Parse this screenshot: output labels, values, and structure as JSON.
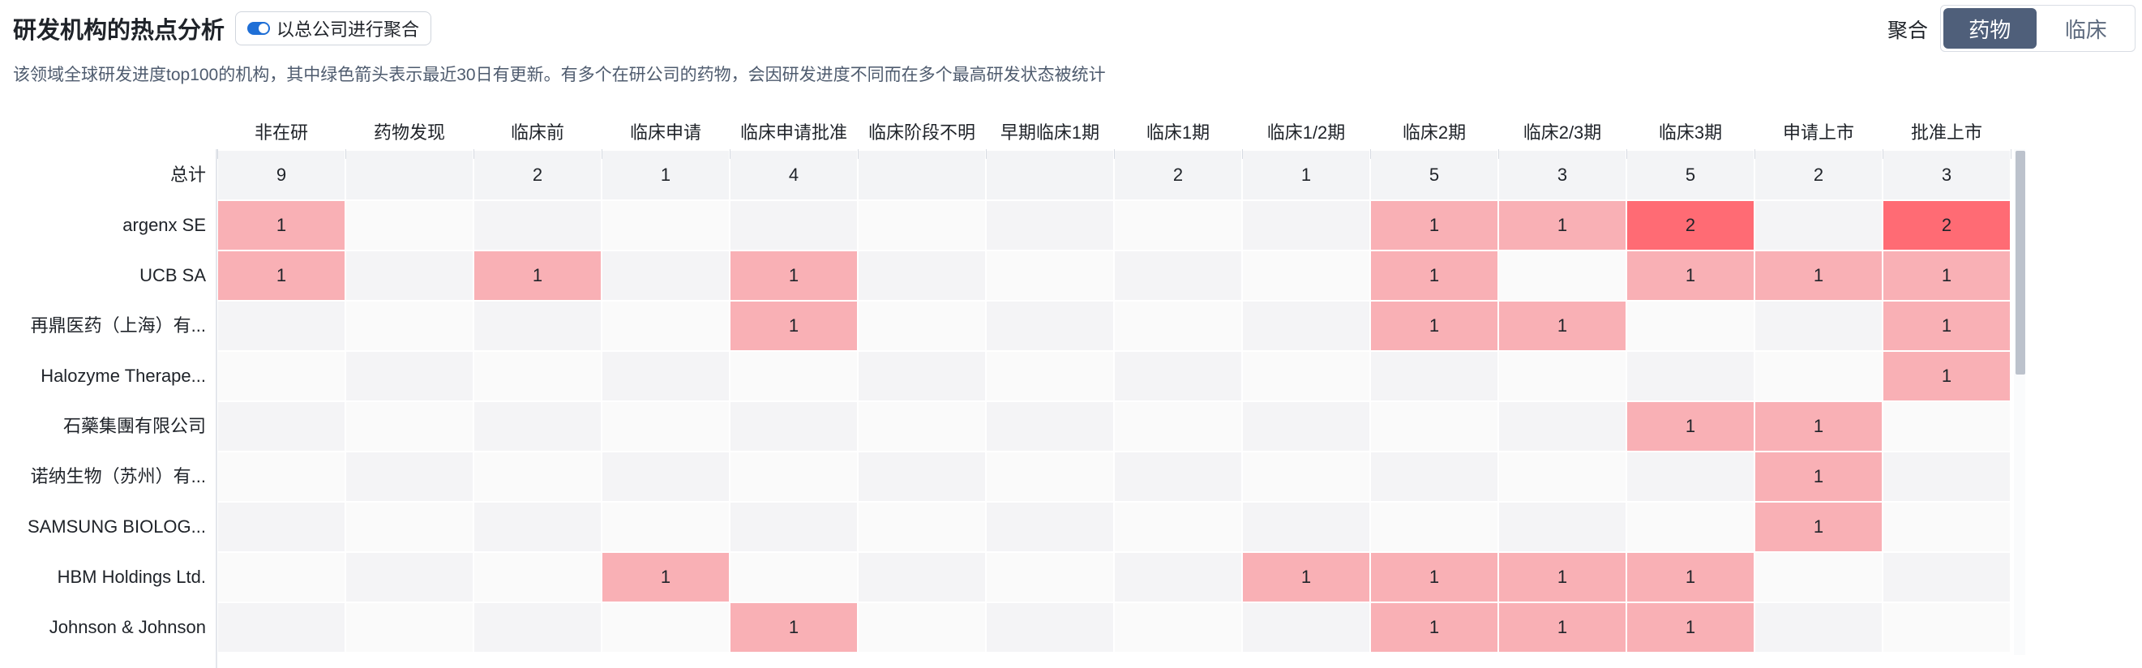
{
  "header": {
    "title": "研发机构的热点分析",
    "aggregate_toggle_label": "以总公司进行聚合",
    "aggregate_toggle_on": true,
    "subtitle": "该领域全球研发进度top100的机构，其中绿色箭头表示最近30日有更新。有多个在研公司的药物，会因研发进度不同而在多个最高研发状态被统计",
    "segment_label": "聚合",
    "segments": [
      {
        "label": "药物",
        "active": true
      },
      {
        "label": "临床",
        "active": false
      }
    ]
  },
  "colors": {
    "low": "#f9b0b5",
    "high": "#ff6b74",
    "total_bg": "#f3f4f6",
    "empty_a": "#fafafa",
    "empty_b": "#f4f4f6"
  },
  "chart_data": {
    "type": "heatmap",
    "columns": [
      "非在研",
      "药物发现",
      "临床前",
      "临床申请",
      "临床申请批准",
      "临床阶段不明",
      "早期临床1期",
      "临床1期",
      "临床1/2期",
      "临床2期",
      "临床2/3期",
      "临床3期",
      "申请上市",
      "批准上市"
    ],
    "total_row": {
      "label": "总计",
      "values": [
        9,
        null,
        2,
        1,
        4,
        null,
        null,
        2,
        1,
        5,
        3,
        5,
        2,
        3
      ]
    },
    "rows": [
      {
        "label": "argenx SE",
        "values": [
          1,
          null,
          null,
          null,
          null,
          null,
          null,
          null,
          null,
          1,
          1,
          2,
          null,
          2
        ]
      },
      {
        "label": "UCB SA",
        "values": [
          1,
          null,
          1,
          null,
          1,
          null,
          null,
          null,
          null,
          1,
          null,
          1,
          1,
          1
        ]
      },
      {
        "label": "再鼎医药（上海）有...",
        "values": [
          null,
          null,
          null,
          null,
          1,
          null,
          null,
          null,
          null,
          1,
          1,
          null,
          null,
          1
        ]
      },
      {
        "label": "Halozyme Therape...",
        "values": [
          null,
          null,
          null,
          null,
          null,
          null,
          null,
          null,
          null,
          null,
          null,
          null,
          null,
          1
        ]
      },
      {
        "label": "石藥集團有限公司",
        "values": [
          null,
          null,
          null,
          null,
          null,
          null,
          null,
          null,
          null,
          null,
          null,
          1,
          1,
          null
        ]
      },
      {
        "label": "诺纳生物（苏州）有...",
        "values": [
          null,
          null,
          null,
          null,
          null,
          null,
          null,
          null,
          null,
          null,
          null,
          null,
          1,
          null
        ]
      },
      {
        "label": "SAMSUNG BIOLOG...",
        "values": [
          null,
          null,
          null,
          null,
          null,
          null,
          null,
          null,
          null,
          null,
          null,
          null,
          1,
          null
        ]
      },
      {
        "label": "HBM Holdings Ltd.",
        "values": [
          null,
          null,
          null,
          1,
          null,
          null,
          null,
          null,
          1,
          1,
          1,
          1,
          null,
          null
        ]
      },
      {
        "label": "Johnson & Johnson",
        "values": [
          null,
          null,
          null,
          null,
          1,
          null,
          null,
          null,
          null,
          1,
          1,
          1,
          null,
          null
        ]
      }
    ]
  }
}
